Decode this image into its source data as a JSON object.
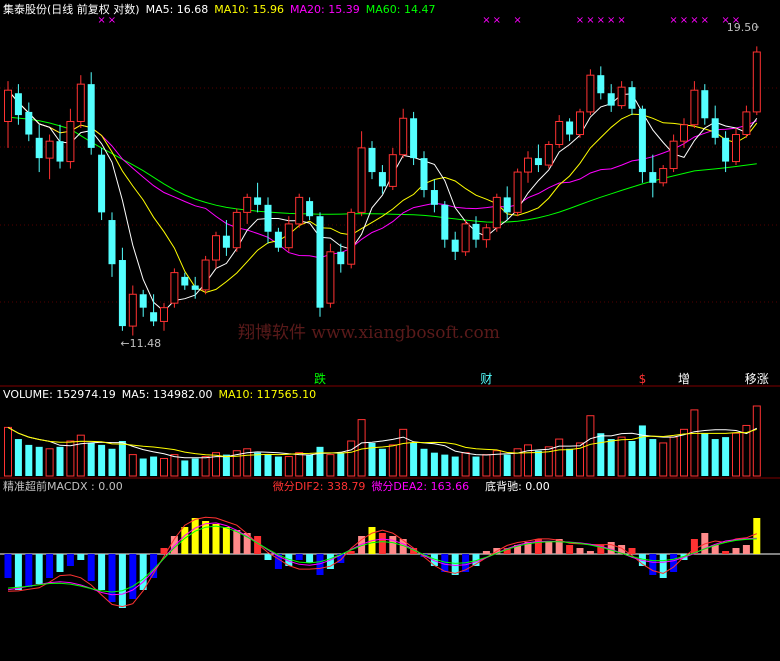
{
  "header": {
    "stock_name": "集泰股份(日线 前复权 对数)",
    "ma5": "MA5: 16.68",
    "ma10": "MA10: 15.96",
    "ma20": "MA20: 15.39",
    "ma60": "MA60: 14.47"
  },
  "volume_header": {
    "volume": "VOLUME: 152974.19",
    "ma5": "MA5: 134982.00",
    "ma10": "MA10: 117565.10"
  },
  "macd_header": {
    "name": "精准超前MACDX : 0.00",
    "dif": "微分DIF2: 338.79",
    "dea": "微分DEA2: 163.66",
    "divergence": "底背驰: 0.00"
  },
  "watermark": "翔博软件 www.xiangbosoft.com",
  "colors": {
    "up": "#ff3232",
    "down": "#54ffff",
    "ma5": "#ffffff",
    "ma10": "#ffff00",
    "ma20": "#ff00ff",
    "ma60": "#00ff00",
    "pink": "#ff8a8a",
    "blue": "#0000ff",
    "magenta": "#ff00ff"
  },
  "chart_data": {
    "type": "candlestick",
    "price_labels": {
      "high": "19.50",
      "low": "←11.48"
    },
    "event_markers": [
      {
        "i": 30,
        "label": "跌",
        "color": "#00ff00"
      },
      {
        "i": 46,
        "label": "财",
        "color": "#54ffff"
      },
      {
        "i": 61,
        "label": "$",
        "color": "#ff3232"
      },
      {
        "i": 65,
        "label": "增",
        "color": "#ffffff"
      },
      {
        "i": 72,
        "label": "移涨",
        "color": "#ffffff"
      }
    ],
    "markers_indices": [
      9,
      10,
      46,
      47,
      49,
      55,
      56,
      57,
      58,
      59,
      64,
      65,
      66,
      67,
      69,
      70
    ],
    "candles": [
      [
        17.0,
        18.3,
        16.2,
        18.0
      ],
      [
        17.9,
        18.2,
        16.9,
        17.2
      ],
      [
        17.3,
        17.6,
        16.4,
        16.6
      ],
      [
        16.5,
        16.9,
        15.5,
        15.9
      ],
      [
        15.9,
        16.6,
        15.3,
        16.4
      ],
      [
        16.4,
        16.9,
        15.6,
        15.8
      ],
      [
        15.8,
        17.4,
        15.6,
        17.0
      ],
      [
        17.0,
        18.5,
        16.8,
        18.2
      ],
      [
        18.2,
        18.6,
        16.0,
        16.2
      ],
      [
        16.0,
        16.2,
        14.2,
        14.4
      ],
      [
        14.2,
        14.4,
        12.8,
        13.1
      ],
      [
        13.2,
        13.5,
        11.6,
        11.7
      ],
      [
        11.7,
        12.6,
        11.5,
        12.4
      ],
      [
        12.4,
        12.5,
        11.9,
        12.1
      ],
      [
        12.0,
        12.4,
        11.7,
        11.8
      ],
      [
        11.8,
        12.2,
        11.6,
        12.1
      ],
      [
        12.2,
        13.0,
        12.1,
        12.9
      ],
      [
        12.8,
        12.9,
        12.5,
        12.6
      ],
      [
        12.6,
        12.8,
        12.3,
        12.5
      ],
      [
        12.5,
        13.3,
        12.4,
        13.2
      ],
      [
        13.2,
        13.9,
        13.0,
        13.8
      ],
      [
        13.8,
        14.2,
        13.3,
        13.5
      ],
      [
        13.5,
        14.5,
        13.4,
        14.4
      ],
      [
        14.4,
        14.9,
        14.1,
        14.8
      ],
      [
        14.8,
        15.2,
        14.4,
        14.6
      ],
      [
        14.6,
        14.8,
        13.6,
        13.9
      ],
      [
        13.9,
        14.0,
        13.4,
        13.5
      ],
      [
        13.5,
        14.3,
        13.4,
        14.1
      ],
      [
        14.1,
        14.9,
        14.0,
        14.8
      ],
      [
        14.7,
        14.8,
        14.2,
        14.3
      ],
      [
        14.3,
        14.4,
        11.9,
        12.1
      ],
      [
        12.2,
        13.6,
        12.1,
        13.4
      ],
      [
        13.4,
        13.6,
        12.9,
        13.1
      ],
      [
        13.1,
        14.5,
        13.0,
        14.4
      ],
      [
        14.4,
        16.7,
        14.3,
        16.2
      ],
      [
        16.2,
        16.4,
        15.3,
        15.5
      ],
      [
        15.5,
        15.7,
        14.9,
        15.1
      ],
      [
        15.1,
        16.2,
        15.0,
        16.0
      ],
      [
        16.0,
        17.4,
        15.9,
        17.1
      ],
      [
        17.1,
        17.3,
        15.7,
        15.9
      ],
      [
        15.9,
        16.1,
        14.8,
        15.0
      ],
      [
        15.0,
        15.3,
        14.4,
        14.6
      ],
      [
        14.6,
        14.7,
        13.5,
        13.7
      ],
      [
        13.7,
        13.9,
        13.2,
        13.4
      ],
      [
        13.4,
        14.2,
        13.3,
        14.1
      ],
      [
        14.1,
        14.3,
        13.5,
        13.7
      ],
      [
        13.7,
        14.1,
        13.5,
        14.0
      ],
      [
        14.0,
        14.9,
        13.9,
        14.8
      ],
      [
        14.8,
        15.1,
        14.2,
        14.4
      ],
      [
        14.4,
        15.6,
        14.3,
        15.5
      ],
      [
        15.5,
        16.1,
        15.2,
        15.9
      ],
      [
        15.9,
        16.3,
        15.5,
        15.7
      ],
      [
        15.7,
        16.4,
        15.6,
        16.3
      ],
      [
        16.3,
        17.2,
        16.2,
        17.0
      ],
      [
        17.0,
        17.1,
        16.4,
        16.6
      ],
      [
        16.6,
        17.4,
        16.5,
        17.3
      ],
      [
        17.3,
        18.7,
        17.2,
        18.5
      ],
      [
        18.5,
        18.8,
        17.7,
        17.9
      ],
      [
        17.9,
        18.2,
        17.3,
        17.5
      ],
      [
        17.5,
        18.3,
        17.4,
        18.1
      ],
      [
        18.1,
        18.3,
        17.2,
        17.4
      ],
      [
        17.4,
        17.5,
        15.2,
        15.5
      ],
      [
        15.5,
        16.0,
        14.8,
        15.2
      ],
      [
        15.2,
        15.7,
        15.1,
        15.6
      ],
      [
        15.6,
        16.6,
        15.5,
        16.4
      ],
      [
        16.4,
        17.1,
        16.2,
        16.9
      ],
      [
        16.9,
        18.3,
        16.8,
        18.0
      ],
      [
        18.0,
        18.2,
        16.9,
        17.1
      ],
      [
        17.1,
        17.5,
        16.3,
        16.5
      ],
      [
        16.5,
        16.7,
        15.5,
        15.8
      ],
      [
        15.8,
        16.8,
        15.7,
        16.6
      ],
      [
        16.6,
        17.5,
        16.5,
        17.3
      ],
      [
        17.3,
        19.5,
        17.2,
        19.3
      ]
    ],
    "volumes": [
      1.25,
      0.95,
      0.8,
      0.75,
      0.7,
      0.75,
      0.9,
      1.05,
      0.85,
      0.8,
      0.7,
      0.9,
      0.55,
      0.45,
      0.5,
      0.45,
      0.55,
      0.4,
      0.45,
      0.5,
      0.6,
      0.55,
      0.65,
      0.7,
      0.6,
      0.55,
      0.5,
      0.5,
      0.6,
      0.55,
      0.75,
      0.55,
      0.6,
      0.9,
      1.45,
      0.85,
      0.7,
      0.8,
      1.2,
      0.85,
      0.7,
      0.6,
      0.55,
      0.5,
      0.6,
      0.5,
      0.55,
      0.65,
      0.55,
      0.7,
      0.8,
      0.65,
      0.75,
      0.95,
      0.7,
      0.85,
      1.55,
      1.1,
      0.95,
      1.0,
      0.9,
      1.3,
      0.95,
      0.85,
      1.0,
      1.2,
      1.7,
      1.1,
      0.95,
      1.0,
      1.1,
      1.3,
      1.8
    ],
    "macd_hist": [
      -0.4,
      -0.6,
      -0.55,
      -0.5,
      -0.4,
      -0.3,
      -0.2,
      -0.1,
      -0.45,
      -0.6,
      -0.8,
      -0.9,
      -0.75,
      -0.6,
      -0.4,
      0.1,
      0.3,
      0.45,
      0.6,
      0.55,
      0.5,
      0.45,
      0.4,
      0.35,
      0.3,
      -0.1,
      -0.25,
      -0.2,
      -0.1,
      -0.15,
      -0.35,
      -0.25,
      -0.15,
      0.05,
      0.3,
      0.45,
      0.35,
      0.3,
      0.25,
      0.1,
      -0.05,
      -0.2,
      -0.3,
      -0.35,
      -0.3,
      -0.2,
      0.05,
      0.1,
      0.1,
      0.15,
      0.2,
      0.25,
      0.2,
      0.25,
      0.15,
      0.1,
      0.05,
      0.15,
      0.2,
      0.15,
      0.1,
      -0.2,
      -0.35,
      -0.4,
      -0.3,
      -0.1,
      0.25,
      0.35,
      0.15,
      0.05,
      0.1,
      0.15,
      0.6
    ]
  }
}
